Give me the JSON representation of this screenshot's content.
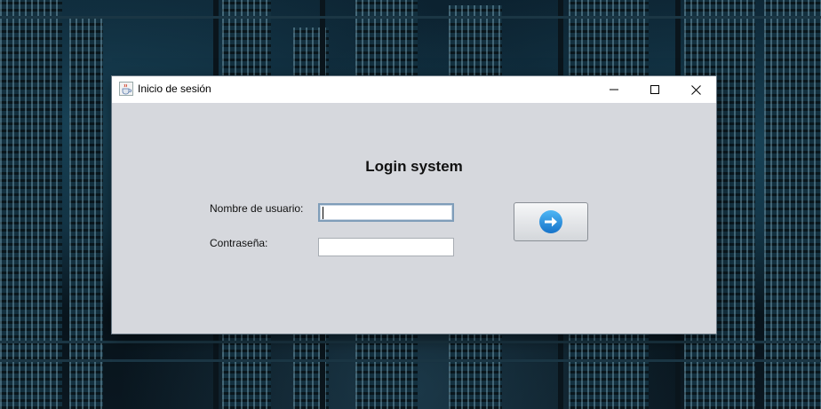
{
  "window": {
    "title": "Inicio de sesión"
  },
  "form": {
    "heading": "Login system",
    "username_label": "Nombre de usuario:",
    "username_value": "",
    "password_label": "Contraseña:",
    "password_value": ""
  },
  "colors": {
    "form_background": "#d6d8dd",
    "submit_icon": "#1e8fe0"
  },
  "icons": {
    "app": "java-cup-icon",
    "submit": "arrow-right-circle-icon"
  }
}
